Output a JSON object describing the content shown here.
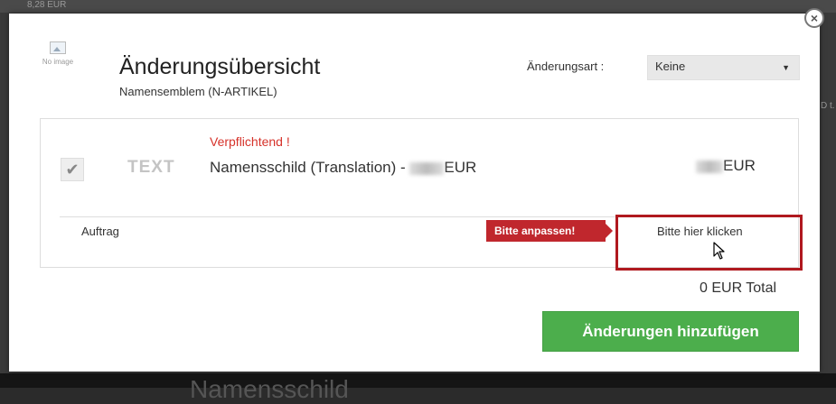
{
  "background": {
    "top_text": "8,28 EUR",
    "bottom_title": "Namensschild",
    "right_text": "D\nt."
  },
  "modal": {
    "thumbnail_label": "No image",
    "title": "Änderungsübersicht",
    "subtitle": "Namensemblem (N-ARTIKEL)",
    "change_type_label": "Änderungsart :",
    "change_type_value": "Keine",
    "item": {
      "required_text": "Verpflichtend !",
      "type_tag": "TEXT",
      "name_prefix": "Namensschild (Translation) - ",
      "name_suffix": "EUR",
      "price_suffix": "EUR",
      "checked": true
    },
    "order_label": "Auftrag",
    "warning_badge": "Bitte anpassen!",
    "click_prompt": "Bitte hier klicken",
    "total": "0 EUR Total",
    "add_button": "Änderungen hinzufügen",
    "close_symbol": "×"
  },
  "colors": {
    "accent_green": "#4cae4c",
    "warning_red": "#c0272d",
    "required_red": "#d6322a"
  },
  "icons": {
    "close": "close-icon",
    "checkbox": "check-icon",
    "cursor": "mouse-pointer-icon",
    "thumbnail": "image-placeholder-icon",
    "select_arrow": "caret-down-icon"
  }
}
